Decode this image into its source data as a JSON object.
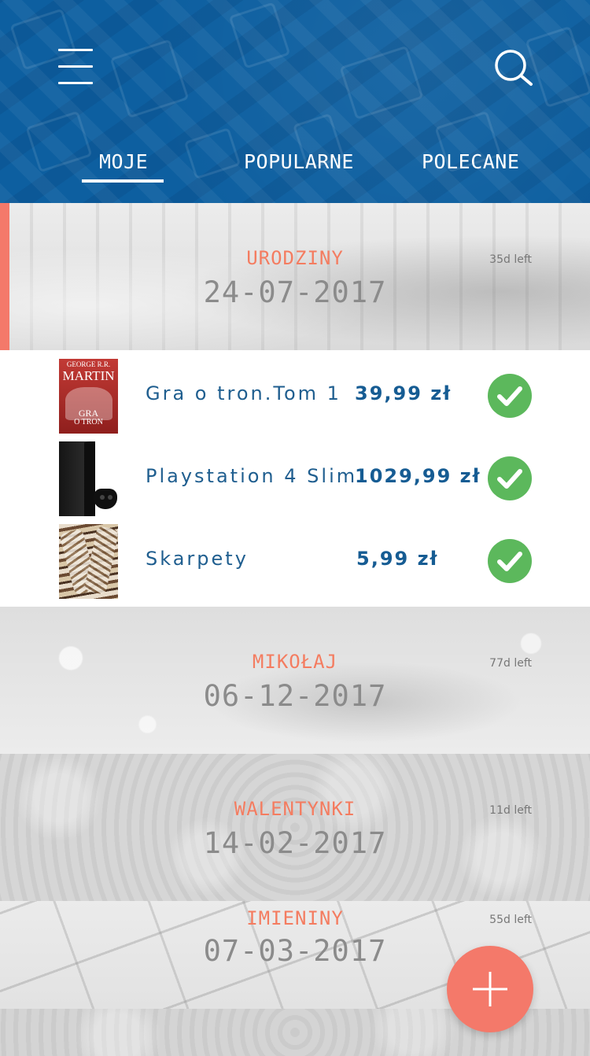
{
  "header": {
    "tabs": [
      {
        "label": "MOJE",
        "active": true
      },
      {
        "label": "POPULARNE",
        "active": false
      },
      {
        "label": "POLECANE",
        "active": false
      }
    ],
    "icons": {
      "menu": "hamburger-menu-icon",
      "search": "search-icon"
    }
  },
  "events": [
    {
      "name": "URODZINY",
      "date": "24-07-2017",
      "days_left": "35d left",
      "expanded": true
    },
    {
      "name": "MIKOŁAJ",
      "date": "06-12-2017",
      "days_left": "77d left",
      "expanded": false
    },
    {
      "name": "WALENTYNKI",
      "date": "14-02-2017",
      "days_left": "11d left",
      "expanded": false
    },
    {
      "name": "IMIENINY",
      "date": "07-03-2017",
      "days_left": "55d left",
      "expanded": false
    }
  ],
  "items": [
    {
      "name": "Gra o tron.Tom 1",
      "price": "39,99 zł",
      "checked": true,
      "thumb": "book-cover-game-of-thrones",
      "cover_author": "GEORGE R.R.",
      "cover_surname": "MARTIN",
      "cover_title1": "GRA",
      "cover_title2": "O TRON"
    },
    {
      "name": "Playstation 4 Slim",
      "price": "1029,99 zł",
      "checked": true,
      "thumb": "playstation-console-image"
    },
    {
      "name": "Skarpety",
      "price": "5,99 zł",
      "checked": true,
      "thumb": "socks-image"
    }
  ],
  "fab": {
    "icon": "plus-icon"
  },
  "colors": {
    "header_blue": "#0d5fa0",
    "accent_coral": "#f4796a",
    "event_name": "#f47c60",
    "price_blue": "#165c93",
    "check_green": "#5cb85c",
    "date_gray": "#8b8b8b"
  }
}
